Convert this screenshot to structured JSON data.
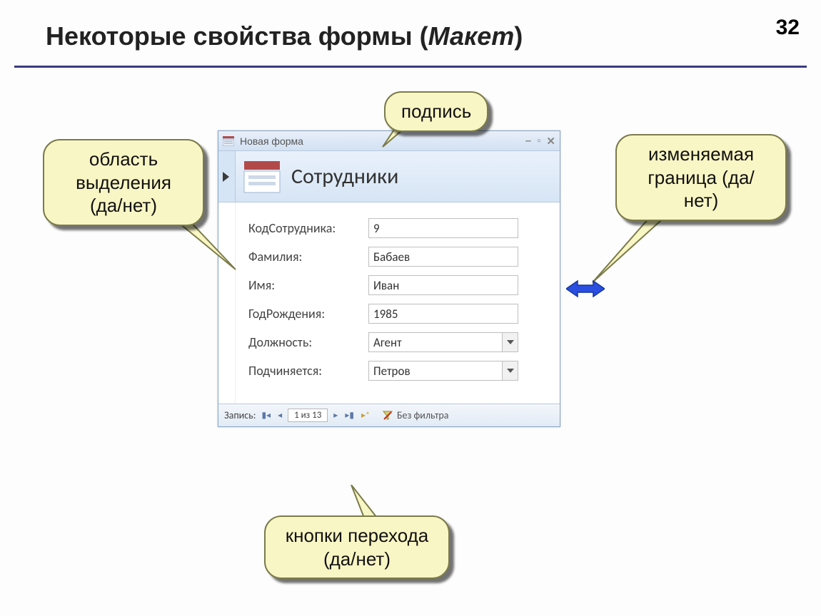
{
  "slide": {
    "title_main": "Некоторые свойства формы (",
    "title_italic": "Макет",
    "title_close": ")",
    "number": "32"
  },
  "callouts": {
    "caption": "подпись",
    "selection_area": "область выделения (да/нет)",
    "resizable_border": "изменяемая граница (да/нет)",
    "nav_buttons": "кнопки перехода (да/нет)"
  },
  "window": {
    "title": "Новая форма",
    "heading": "Сотрудники",
    "record_nav": {
      "label": "Запись:",
      "position": "1 из 13",
      "no_filter": "Без фильтра"
    }
  },
  "fields": [
    {
      "label": "КодСотрудника:",
      "value": "9",
      "type": "text"
    },
    {
      "label": "Фамилия:",
      "value": "Бабаев",
      "type": "text"
    },
    {
      "label": "Имя:",
      "value": "Иван",
      "type": "text"
    },
    {
      "label": "ГодРождения:",
      "value": "1985",
      "type": "text"
    },
    {
      "label": "Должность:",
      "value": "Агент",
      "type": "combo"
    },
    {
      "label": "Подчиняется:",
      "value": "Петров",
      "type": "combo"
    }
  ]
}
